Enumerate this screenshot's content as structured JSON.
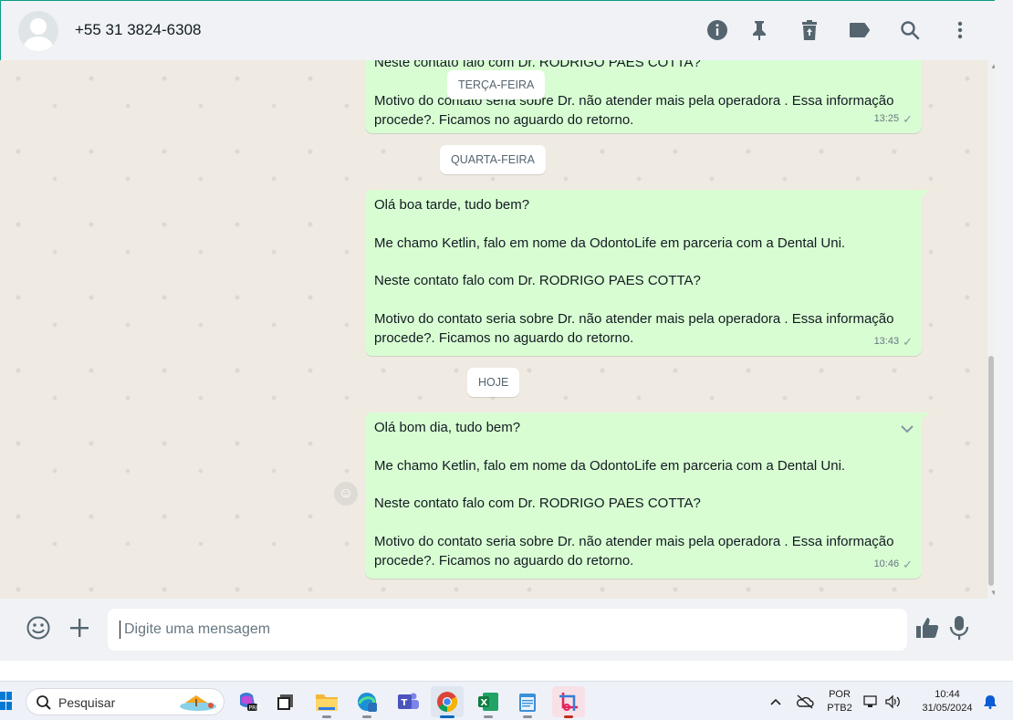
{
  "header": {
    "contact_name": "+55 31 3824-6308",
    "icons": [
      "info-icon",
      "pin-icon",
      "delete-icon",
      "label-icon",
      "search-icon",
      "menu-icon"
    ]
  },
  "chat": {
    "dates": {
      "tuesday": "TERÇA-FEIRA",
      "wednesday": "QUARTA-FEIRA",
      "today": "HOJE"
    },
    "messages": [
      {
        "partial_top": "Neste contato falo com Dr. RODRIGO PAES COTTA?",
        "line_motivo": "Motivo do contato seria sobre Dr. não atender mais pela operadora . Essa informação",
        "line_procede": "procede?. Ficamos no aguardo do retorno.",
        "time": "13:25"
      },
      {
        "greeting": "Olá boa tarde, tudo bem?",
        "intro": "Me chamo Ketlin, falo em nome da OdontoLife em parceria com a Dental Uni.",
        "question": "Neste contato falo com Dr. RODRIGO PAES COTTA?",
        "line_motivo": "Motivo do contato seria sobre Dr. não atender mais pela operadora . Essa informação",
        "line_procede": "procede?. Ficamos no aguardo do retorno.",
        "time": "13:43"
      },
      {
        "greeting": "Olá bom dia, tudo bem?",
        "intro": "Me chamo Ketlin, falo em nome da OdontoLife em parceria com a Dental Uni.",
        "question": "Neste contato falo com Dr. RODRIGO PAES COTTA?",
        "line_motivo": "Motivo do contato seria sobre Dr. não atender mais pela operadora . Essa informação",
        "line_procede": "procede?. Ficamos no aguardo do retorno.",
        "time": "10:46"
      }
    ]
  },
  "composer": {
    "placeholder": "Digite uma mensagem"
  },
  "taskbar": {
    "search_label": "Pesquisar",
    "language": "POR",
    "layout": "PTB2",
    "time": "10:44",
    "date": "31/05/2024"
  },
  "colors": {
    "outgoing_bubble": "#d9fdd3",
    "chat_background": "#efeae2",
    "accent": "#00a884"
  }
}
